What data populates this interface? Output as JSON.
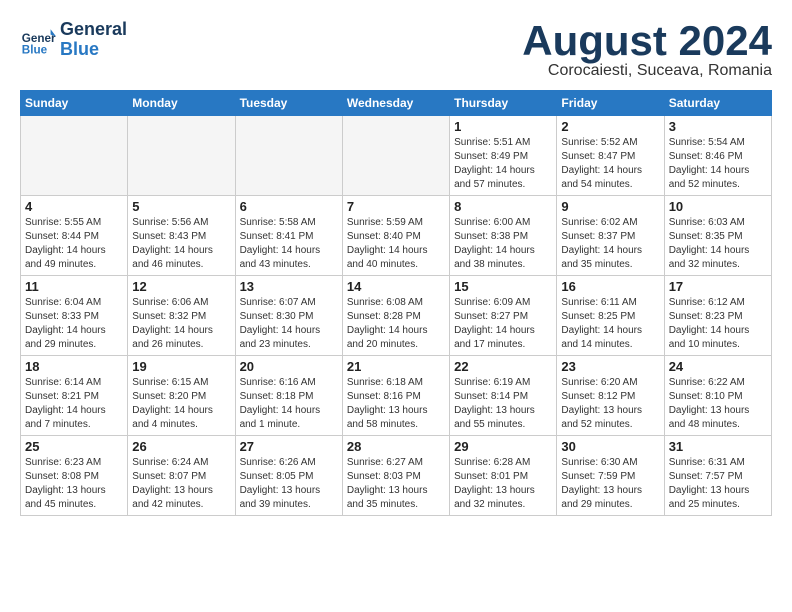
{
  "header": {
    "logo_line1": "General",
    "logo_line2": "Blue",
    "month_year": "August 2024",
    "location": "Corocaiesti, Suceava, Romania"
  },
  "weekdays": [
    "Sunday",
    "Monday",
    "Tuesday",
    "Wednesday",
    "Thursday",
    "Friday",
    "Saturday"
  ],
  "weeks": [
    [
      {
        "day": "",
        "info": ""
      },
      {
        "day": "",
        "info": ""
      },
      {
        "day": "",
        "info": ""
      },
      {
        "day": "",
        "info": ""
      },
      {
        "day": "1",
        "info": "Sunrise: 5:51 AM\nSunset: 8:49 PM\nDaylight: 14 hours\nand 57 minutes."
      },
      {
        "day": "2",
        "info": "Sunrise: 5:52 AM\nSunset: 8:47 PM\nDaylight: 14 hours\nand 54 minutes."
      },
      {
        "day": "3",
        "info": "Sunrise: 5:54 AM\nSunset: 8:46 PM\nDaylight: 14 hours\nand 52 minutes."
      }
    ],
    [
      {
        "day": "4",
        "info": "Sunrise: 5:55 AM\nSunset: 8:44 PM\nDaylight: 14 hours\nand 49 minutes."
      },
      {
        "day": "5",
        "info": "Sunrise: 5:56 AM\nSunset: 8:43 PM\nDaylight: 14 hours\nand 46 minutes."
      },
      {
        "day": "6",
        "info": "Sunrise: 5:58 AM\nSunset: 8:41 PM\nDaylight: 14 hours\nand 43 minutes."
      },
      {
        "day": "7",
        "info": "Sunrise: 5:59 AM\nSunset: 8:40 PM\nDaylight: 14 hours\nand 40 minutes."
      },
      {
        "day": "8",
        "info": "Sunrise: 6:00 AM\nSunset: 8:38 PM\nDaylight: 14 hours\nand 38 minutes."
      },
      {
        "day": "9",
        "info": "Sunrise: 6:02 AM\nSunset: 8:37 PM\nDaylight: 14 hours\nand 35 minutes."
      },
      {
        "day": "10",
        "info": "Sunrise: 6:03 AM\nSunset: 8:35 PM\nDaylight: 14 hours\nand 32 minutes."
      }
    ],
    [
      {
        "day": "11",
        "info": "Sunrise: 6:04 AM\nSunset: 8:33 PM\nDaylight: 14 hours\nand 29 minutes."
      },
      {
        "day": "12",
        "info": "Sunrise: 6:06 AM\nSunset: 8:32 PM\nDaylight: 14 hours\nand 26 minutes."
      },
      {
        "day": "13",
        "info": "Sunrise: 6:07 AM\nSunset: 8:30 PM\nDaylight: 14 hours\nand 23 minutes."
      },
      {
        "day": "14",
        "info": "Sunrise: 6:08 AM\nSunset: 8:28 PM\nDaylight: 14 hours\nand 20 minutes."
      },
      {
        "day": "15",
        "info": "Sunrise: 6:09 AM\nSunset: 8:27 PM\nDaylight: 14 hours\nand 17 minutes."
      },
      {
        "day": "16",
        "info": "Sunrise: 6:11 AM\nSunset: 8:25 PM\nDaylight: 14 hours\nand 14 minutes."
      },
      {
        "day": "17",
        "info": "Sunrise: 6:12 AM\nSunset: 8:23 PM\nDaylight: 14 hours\nand 10 minutes."
      }
    ],
    [
      {
        "day": "18",
        "info": "Sunrise: 6:14 AM\nSunset: 8:21 PM\nDaylight: 14 hours\nand 7 minutes."
      },
      {
        "day": "19",
        "info": "Sunrise: 6:15 AM\nSunset: 8:20 PM\nDaylight: 14 hours\nand 4 minutes."
      },
      {
        "day": "20",
        "info": "Sunrise: 6:16 AM\nSunset: 8:18 PM\nDaylight: 14 hours\nand 1 minute."
      },
      {
        "day": "21",
        "info": "Sunrise: 6:18 AM\nSunset: 8:16 PM\nDaylight: 13 hours\nand 58 minutes."
      },
      {
        "day": "22",
        "info": "Sunrise: 6:19 AM\nSunset: 8:14 PM\nDaylight: 13 hours\nand 55 minutes."
      },
      {
        "day": "23",
        "info": "Sunrise: 6:20 AM\nSunset: 8:12 PM\nDaylight: 13 hours\nand 52 minutes."
      },
      {
        "day": "24",
        "info": "Sunrise: 6:22 AM\nSunset: 8:10 PM\nDaylight: 13 hours\nand 48 minutes."
      }
    ],
    [
      {
        "day": "25",
        "info": "Sunrise: 6:23 AM\nSunset: 8:08 PM\nDaylight: 13 hours\nand 45 minutes."
      },
      {
        "day": "26",
        "info": "Sunrise: 6:24 AM\nSunset: 8:07 PM\nDaylight: 13 hours\nand 42 minutes."
      },
      {
        "day": "27",
        "info": "Sunrise: 6:26 AM\nSunset: 8:05 PM\nDaylight: 13 hours\nand 39 minutes."
      },
      {
        "day": "28",
        "info": "Sunrise: 6:27 AM\nSunset: 8:03 PM\nDaylight: 13 hours\nand 35 minutes."
      },
      {
        "day": "29",
        "info": "Sunrise: 6:28 AM\nSunset: 8:01 PM\nDaylight: 13 hours\nand 32 minutes."
      },
      {
        "day": "30",
        "info": "Sunrise: 6:30 AM\nSunset: 7:59 PM\nDaylight: 13 hours\nand 29 minutes."
      },
      {
        "day": "31",
        "info": "Sunrise: 6:31 AM\nSunset: 7:57 PM\nDaylight: 13 hours\nand 25 minutes."
      }
    ]
  ]
}
